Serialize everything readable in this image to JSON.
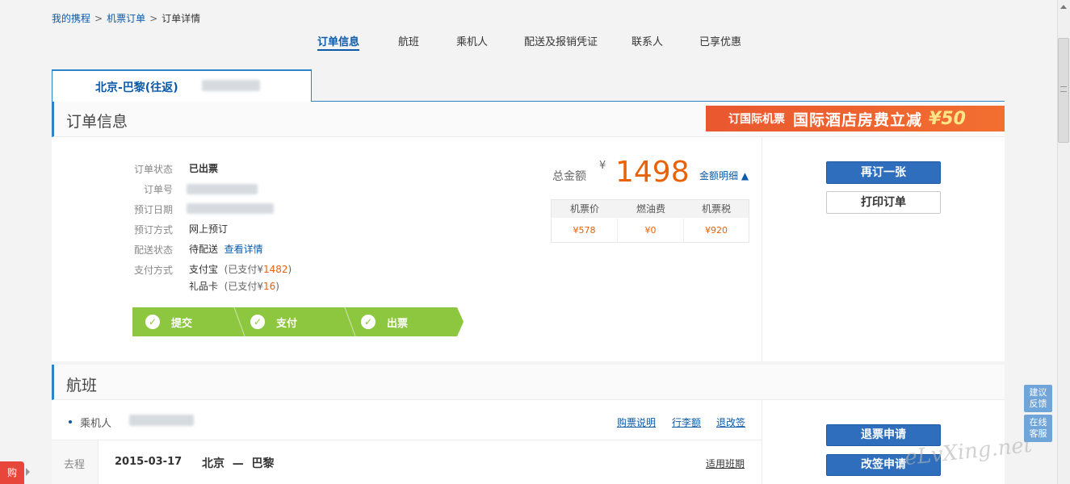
{
  "breadcrumb": {
    "home": "我的携程",
    "orders": "机票订单",
    "current": "订单详情",
    "sep": ">"
  },
  "top_tabs": [
    "订单信息",
    "航班",
    "乘机人",
    "配送及报销凭证",
    "联系人",
    "已享优惠"
  ],
  "route": {
    "label": "北京-巴黎(往返)"
  },
  "order_section": {
    "title": "订单信息",
    "rows": {
      "status_label": "订单状态",
      "status_value": "已出票",
      "order_no_label": "订单号",
      "date_label": "预订日期",
      "method_label": "预订方式",
      "method_value": "网上预订",
      "delivery_label": "配送状态",
      "delivery_value": "待配送",
      "delivery_link": "查看详情",
      "pay_label": "支付方式",
      "pay1_name": "支付宝",
      "pay1_prefix": "(已支付¥",
      "pay1_amount": "1482",
      "pay1_suffix": ")",
      "pay2_name": "礼品卡",
      "pay2_prefix": "(已支付¥",
      "pay2_amount": "16",
      "pay2_suffix": ")"
    },
    "steps": [
      "提交",
      "支付",
      "出票"
    ],
    "step_check": "✓"
  },
  "promo": {
    "part1": "订国际机票",
    "part2": "国际酒店房费立减",
    "part3": "¥50"
  },
  "price": {
    "total_label": "总金额",
    "currency": "¥",
    "total": "1498",
    "detail_link": "金额明细",
    "headers": [
      "机票价",
      "燃油费",
      "机票税"
    ],
    "values": [
      "¥578",
      "¥0",
      "¥920"
    ]
  },
  "actions": {
    "rebook": "再订一张",
    "print": "打印订单",
    "refund": "退票申请",
    "change": "改签申请"
  },
  "flight_section": {
    "title": "航班",
    "passenger_label": "乘机人",
    "links": [
      "购票说明",
      "行李额",
      "退改签"
    ],
    "leg_label": "去程",
    "date": "2015-03-17",
    "from": "北京",
    "dash": "—",
    "to": "巴黎",
    "flight_link": "适用班期"
  },
  "float": {
    "feedback": "建议反馈",
    "service": "在线客服"
  },
  "watermark": "eLvXing.net",
  "corner_icon": "购",
  "colors": {
    "accent": "#2d83c8",
    "link": "#0b5aa9",
    "price": "#e8620a",
    "progress": "#8dc63f",
    "button": "#2e6ebd"
  }
}
